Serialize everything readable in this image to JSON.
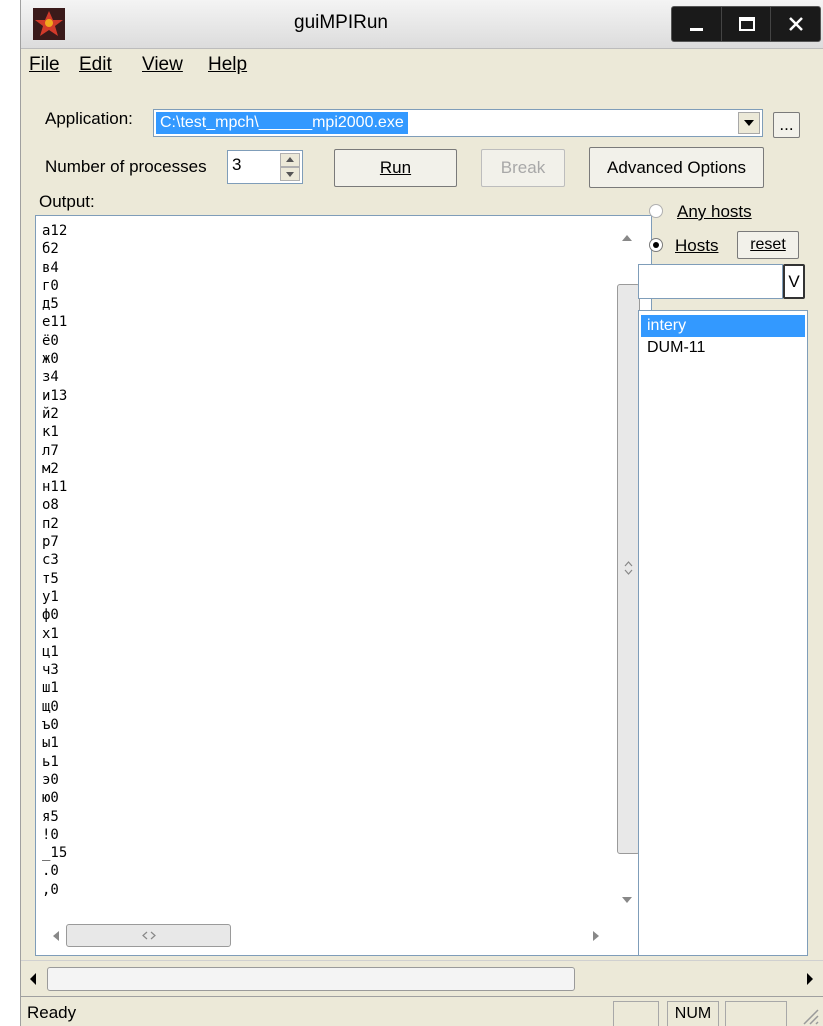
{
  "window": {
    "title": "guiMPIRun"
  },
  "menu": [
    "File",
    "Edit",
    "View",
    "Help"
  ],
  "application": {
    "label": "Application:",
    "path": "C:\\test_mpch\\______mpi2000.exe",
    "browse_label": "..."
  },
  "processes": {
    "label": "Number of processes",
    "value": "3"
  },
  "buttons": {
    "run": "Run",
    "break": "Break",
    "advanced": "Advanced Options"
  },
  "output": {
    "label": "Output:",
    "lines": [
      "а12",
      "б2",
      "в4",
      "г0",
      "д5",
      "е11",
      "ё0",
      "ж0",
      "з4",
      "и13",
      "й2",
      "к1",
      "л7",
      "м2",
      "н11",
      "о8",
      "п2",
      "р7",
      "с3",
      "т5",
      "у1",
      "ф0",
      "х1",
      "ц1",
      "ч3",
      "ш1",
      "щ0",
      "ъ0",
      "ы1",
      "ь1",
      "э0",
      "ю0",
      "я5",
      "!0",
      "_15",
      ".0",
      ",0"
    ]
  },
  "hosts": {
    "any_hosts_label": "Any hosts",
    "hosts_label": "Hosts",
    "reset_label": "reset",
    "selected_mode": "hosts",
    "input_value": "",
    "add_button_label": "V",
    "list": [
      "intery",
      "DUM-11"
    ],
    "selected_index": 0
  },
  "status": {
    "text": "Ready",
    "num": "NUM"
  },
  "colors": {
    "selection": "#3399ff",
    "titlebar_buttons": "#1a1a1a",
    "window_bg": "#ece9d8"
  }
}
